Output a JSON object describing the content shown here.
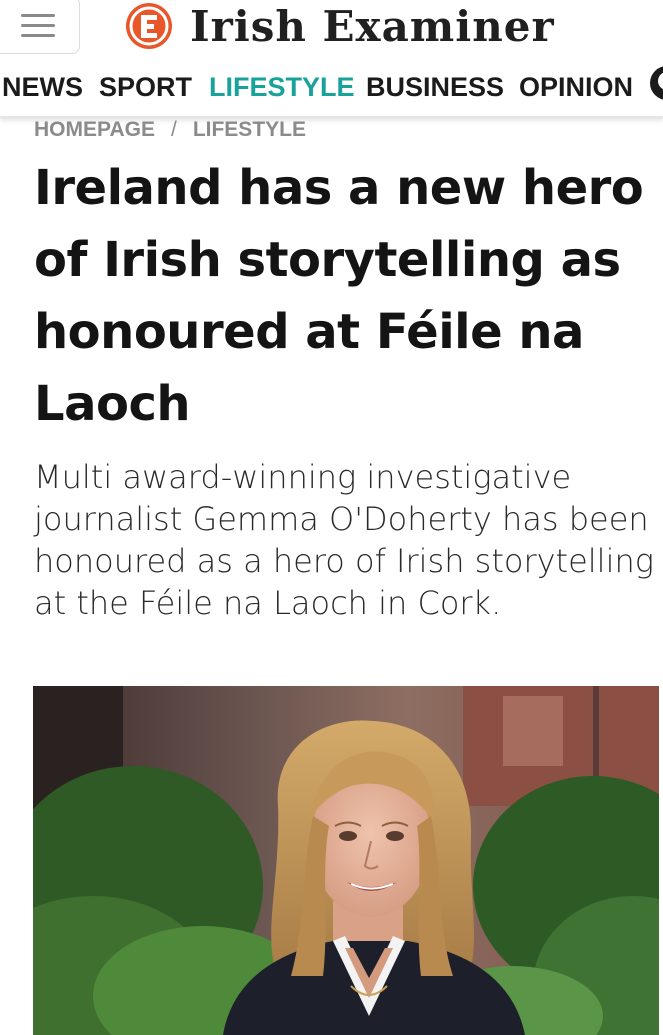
{
  "header": {
    "brand_name": "Irish Examiner",
    "logo_icon": "irish-examiner-logo",
    "menu_icon": "hamburger-icon",
    "brand_color": "#e8572a"
  },
  "nav": {
    "items": [
      {
        "label": "NEWS",
        "active": false
      },
      {
        "label": "SPORT",
        "active": false
      },
      {
        "label": "LIFESTYLE",
        "active": true
      },
      {
        "label": "BUSINESS",
        "active": false
      },
      {
        "label": "OPINION",
        "active": false
      }
    ],
    "active_color": "#18a39a",
    "account_icon": "user-account-icon"
  },
  "breadcrumb": {
    "home": "HOMEPAGE",
    "separator": "/",
    "section": "LIFESTYLE"
  },
  "article": {
    "headline": "Ireland has a new hero of Irish storytelling as honoured at Féile na Laoch",
    "standfirst": "Multi award-winning investigative journalist Gemma O'Doherty has been honoured as a hero of Irish storytelling at the Féile na Laoch in Cork.",
    "image_subject": "photo of a smiling woman with shoulder-length blonde hair outdoors"
  }
}
